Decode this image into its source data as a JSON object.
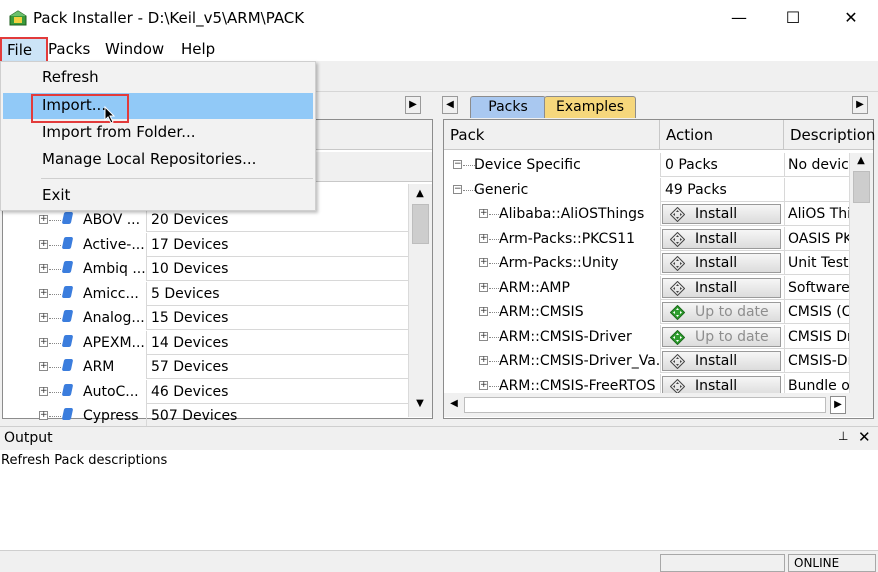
{
  "window": {
    "title": "Pack Installer - D:\\Keil_v5\\ARM\\PACK",
    "minimize": "—",
    "maximize": "☐",
    "close": "✕"
  },
  "menubar": [
    "File",
    "Packs",
    "Window",
    "Help"
  ],
  "file_menu": {
    "items": [
      "Refresh",
      "Import...",
      "Import from Folder...",
      "Manage Local Repositories...",
      "Exit"
    ],
    "highlighted": "Import..."
  },
  "left_panel": {
    "rows": [
      {
        "name": "ABOV ...",
        "count": "20 Devices"
      },
      {
        "name": "Active-...",
        "count": "17 Devices"
      },
      {
        "name": "Ambiq ...",
        "count": "10 Devices"
      },
      {
        "name": "Amicc...",
        "count": "5 Devices"
      },
      {
        "name": "Analog...",
        "count": "15 Devices"
      },
      {
        "name": "APEXM...",
        "count": "14 Devices"
      },
      {
        "name": "ARM",
        "count": "57 Devices"
      },
      {
        "name": "AutoC...",
        "count": "46 Devices"
      },
      {
        "name": "Cypress",
        "count": "507 Devices"
      }
    ]
  },
  "right_panel": {
    "tabs": [
      "Packs",
      "Examples"
    ],
    "columns": [
      "Pack",
      "Action",
      "Description"
    ],
    "rows": [
      {
        "pack": "Device Specific",
        "action": "0 Packs",
        "description": "No device",
        "type": "group"
      },
      {
        "pack": "Generic",
        "action": "49 Packs",
        "description": "",
        "type": "group"
      },
      {
        "pack": "Alibaba::AliOSThings",
        "action": "Install",
        "description": "AliOS Thir",
        "type": "install"
      },
      {
        "pack": "Arm-Packs::PKCS11",
        "action": "Install",
        "description": "OASIS PKC",
        "type": "install"
      },
      {
        "pack": "Arm-Packs::Unity",
        "action": "Install",
        "description": "Unit Testir",
        "type": "install"
      },
      {
        "pack": "ARM::AMP",
        "action": "Install",
        "description": "Software c",
        "type": "install"
      },
      {
        "pack": "ARM::CMSIS",
        "action": "Up to date",
        "description": "CMSIS (Co",
        "type": "uptodate"
      },
      {
        "pack": "ARM::CMSIS-Driver",
        "action": "Up to date",
        "description": "CMSIS Dri",
        "type": "uptodate"
      },
      {
        "pack": "ARM::CMSIS-Driver_Va...",
        "action": "Install",
        "description": "CMSIS-Dr",
        "type": "install"
      },
      {
        "pack": "ARM::CMSIS-FreeRTOS",
        "action": "Install",
        "description": "Bundle of",
        "type": "install"
      }
    ]
  },
  "output": {
    "title": "Output",
    "text": "Refresh Pack descriptions",
    "pin": "📌",
    "close": "✕"
  },
  "status": {
    "online": "ONLINE"
  },
  "colors": {
    "menu_highlight": "#91c9f7",
    "red_outline": "#e23b3b",
    "tab_packs": "#a9c8f0",
    "tab_examples": "#f6d77c",
    "install_icon": "#444444",
    "uptodate_icon": "#2e9e2e"
  }
}
